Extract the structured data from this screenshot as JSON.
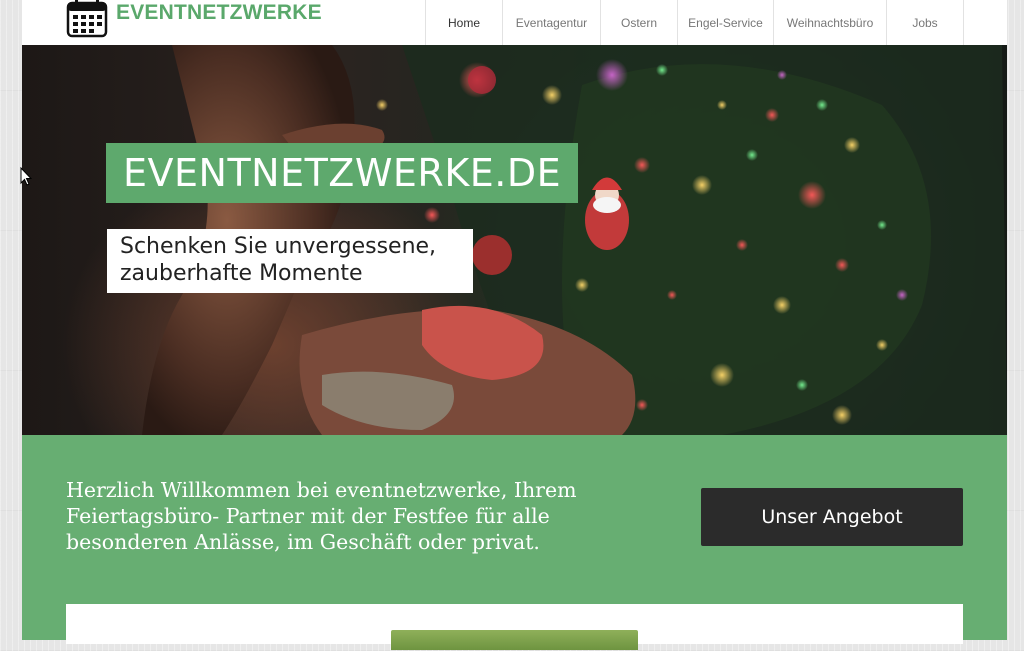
{
  "header": {
    "logo_text": "EVENTNETZWERKE",
    "nav": [
      {
        "label": "Home",
        "active": true
      },
      {
        "label": "Eventagentur",
        "active": false
      },
      {
        "label": "Ostern",
        "active": false
      },
      {
        "label": "Engel-Service",
        "active": false
      },
      {
        "label": "Weihnachtsbüro",
        "active": false
      },
      {
        "label": "Jobs",
        "active": false
      }
    ]
  },
  "hero": {
    "title": "EVENTNETZWERKE.DE",
    "subtitle_line1": "Schenken Sie unvergessene,",
    "subtitle_line2": "zauberhafte Momente"
  },
  "welcome": {
    "text": "Herzlich Willkommen bei eventnetzwerke, Ihrem Feiertagsbüro- Partner mit der Festfee für alle besonderen Anlässe, im Geschäft oder privat.",
    "button_label": "Unser Angebot"
  },
  "colors": {
    "brand_green": "#5ea96d",
    "band_green": "#67ae72",
    "button_dark": "#2b2b2b",
    "logo_green": "#5aa86b"
  },
  "icons": {
    "logo": "calendar-icon",
    "cursor": "mouse-cursor-icon"
  }
}
